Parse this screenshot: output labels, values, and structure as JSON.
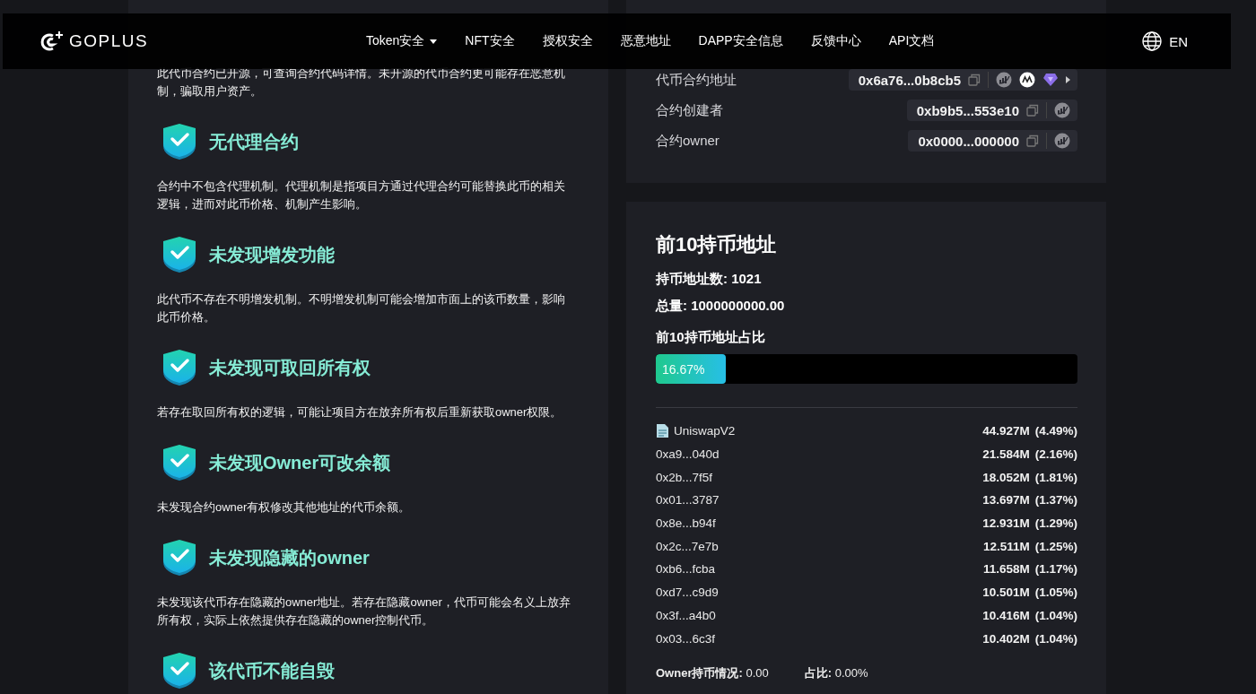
{
  "nav": {
    "logo": "GOPLUS",
    "items": [
      {
        "label": "Token安全",
        "has_menu": true
      },
      {
        "label": "NFT安全",
        "has_menu": false
      },
      {
        "label": "授权安全",
        "has_menu": false
      },
      {
        "label": "恶意地址",
        "has_menu": false
      },
      {
        "label": "DAPP安全信息",
        "has_menu": false
      },
      {
        "label": "反馈中心",
        "has_menu": false
      },
      {
        "label": "API文档",
        "has_menu": false
      }
    ],
    "language": "EN"
  },
  "checks": [
    {
      "description": "此代币合约已开源，可查询合约代码详情。未开源的代币合约更可能存在恶意机制，骗取用户资产。"
    },
    {
      "title": "无代理合约",
      "description": "合约中不包含代理机制。代理机制是指项目方通过代理合约可能替换此币的相关逻辑，进而对此币价格、机制产生影响。"
    },
    {
      "title": "未发现增发功能",
      "description": "此代币不存在不明增发机制。不明增发机制可能会增加市面上的该币数量，影响此币价格。"
    },
    {
      "title": "未发现可取回所有权",
      "description": "若存在取回所有权的逻辑，可能让项目方在放弃所有权后重新获取owner权限。"
    },
    {
      "title": "未发现Owner可改余额",
      "description": "未发现合约owner有权修改其他地址的代币余额。"
    },
    {
      "title": "未发现隐藏的owner",
      "description": "未发现该代币存在隐藏的owner地址。若存在隐藏owner，代币可能会名义上放弃所有权，实际上依然提供存在隐藏的owner控制代币。"
    },
    {
      "title": "该代币不能自毁"
    }
  ],
  "token_info": {
    "rows": [
      {
        "kind": "address",
        "label": "代币合约地址",
        "value": "0x6a76...0b8cb5",
        "extra_links": true
      },
      {
        "kind": "address",
        "label": "合约创建者",
        "value": "0xb9b5...553e10",
        "extra_links": false
      },
      {
        "kind": "address",
        "label": "合约owner",
        "value": "0x0000...000000",
        "extra_links": false
      }
    ]
  },
  "holders": {
    "title": "前10持币地址",
    "count": "持币地址数: 1021",
    "total": "总量: 1000000000.00",
    "share_label": "前10持币地址占比",
    "share": {
      "level": 0.1667,
      "text": "16.67%"
    },
    "rows": [
      {
        "kind": "contract",
        "address": "UniswapV2",
        "amount": "44.927M",
        "percent": "(4.49%)"
      },
      {
        "kind": "wallet",
        "address": "0xa9...040d",
        "amount": "21.584M",
        "percent": "(2.16%)"
      },
      {
        "kind": "wallet",
        "address": "0x2b...7f5f",
        "amount": "18.052M",
        "percent": "(1.81%)"
      },
      {
        "kind": "wallet",
        "address": "0x01...3787",
        "amount": "13.697M",
        "percent": "(1.37%)"
      },
      {
        "kind": "wallet",
        "address": "0x8e...b94f",
        "amount": "12.931M",
        "percent": "(1.29%)"
      },
      {
        "kind": "wallet",
        "address": "0x2c...7e7b",
        "amount": "12.511M",
        "percent": "(1.25%)"
      },
      {
        "kind": "wallet",
        "address": "0xb6...fcba",
        "amount": "11.658M",
        "percent": "(1.17%)"
      },
      {
        "kind": "wallet",
        "address": "0xd7...c9d9",
        "amount": "10.501M",
        "percent": "(1.05%)"
      },
      {
        "kind": "wallet",
        "address": "0x3f...a4b0",
        "amount": "10.416M",
        "percent": "(1.04%)"
      },
      {
        "kind": "wallet",
        "address": "0x03...6c3f",
        "amount": "10.402M",
        "percent": "(1.04%)"
      }
    ],
    "owner_holding": "**Owner持币情况:** 0.00",
    "owner_share": "**占比:** 0.00%"
  }
}
